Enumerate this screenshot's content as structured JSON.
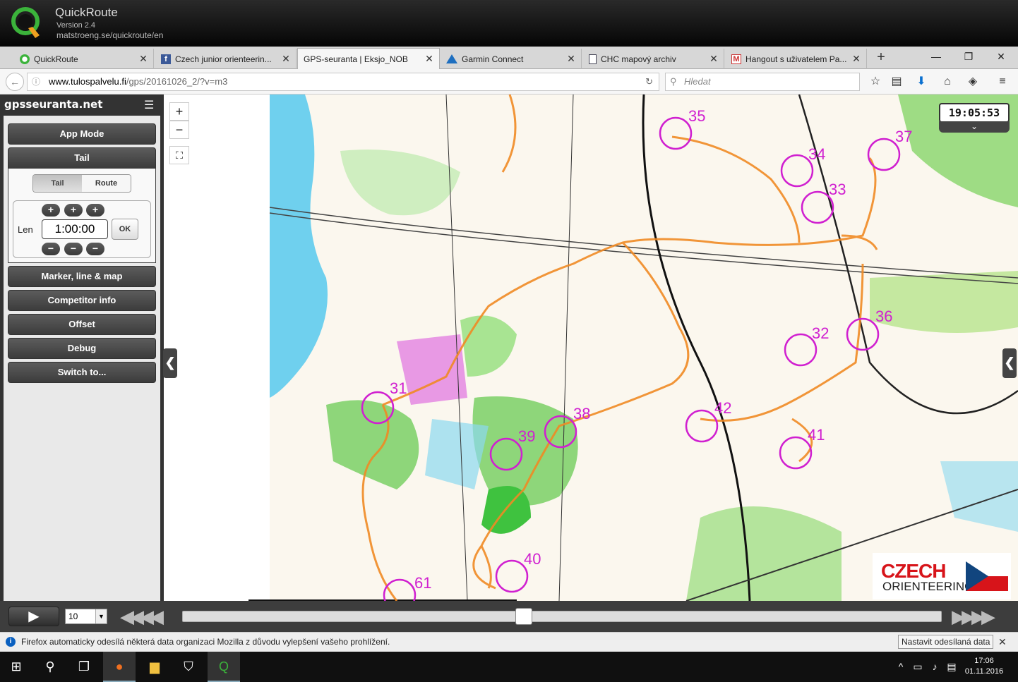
{
  "quickroute": {
    "title": "QuickRoute",
    "version": "Version 2.4",
    "url": "matstroeng.se/quickroute/en"
  },
  "tabs": [
    {
      "label": "QuickRoute",
      "icon": "quickroute-icon"
    },
    {
      "label": "Czech junior orienteerin...",
      "icon": "facebook-icon"
    },
    {
      "label": "GPS-seuranta | Eksjo_NOB",
      "icon": "none",
      "active": true
    },
    {
      "label": "Garmin Connect",
      "icon": "garmin-icon"
    },
    {
      "label": "CHC mapový archiv",
      "icon": "document-icon"
    },
    {
      "label": "Hangout s uživatelem Pa...",
      "icon": "gmail-icon"
    }
  ],
  "navbar": {
    "url_domain": "www.tulospalvelu.fi",
    "url_path": "/gps/20161026_2/?v=m3",
    "search_placeholder": "Hledat"
  },
  "panel": {
    "brand": "gpsseuranta.net",
    "buttons": {
      "app_mode": "App Mode",
      "tail": "Tail",
      "marker": "Marker, line & map",
      "competitor": "Competitor info",
      "offset": "Offset",
      "debug": "Debug",
      "switch": "Switch to..."
    },
    "segment": {
      "tail": "Tail",
      "route": "Route"
    },
    "len_label": "Len",
    "len_value": "1:00:00",
    "ok": "OK",
    "plus": "+",
    "minus": "−"
  },
  "map": {
    "clock": "19:05:53",
    "controls": [
      "35",
      "37",
      "34",
      "33",
      "36",
      "32",
      "31",
      "42",
      "41",
      "39",
      "38",
      "40",
      "61"
    ],
    "logo_line1": "CZECH",
    "logo_line2": "ORIENTEERING",
    "colors": {
      "route": "#f08a24",
      "control": "#d020d0",
      "green": "#8ed67a",
      "water": "#6fd0ee"
    }
  },
  "playback": {
    "speed": "10",
    "progress": 0.45
  },
  "notification": {
    "text": "Firefox automaticky odesílá některá data organizaci Mozilla z důvodu vylepšení vašeho prohlížení.",
    "button": "Nastavit odesílaná data"
  },
  "taskbar": {
    "time": "17:06",
    "date": "01.11.2016"
  }
}
